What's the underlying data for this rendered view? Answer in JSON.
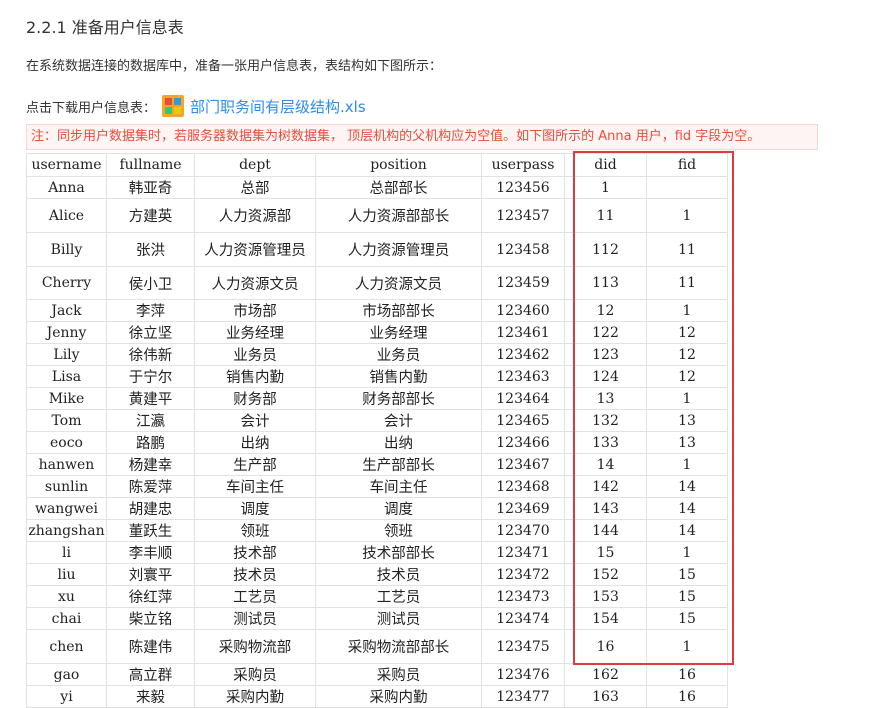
{
  "section_title": "2.2.1 准备用户信息表",
  "intro": "在系统数据连接的数据库中，准备一张用户信息表，表结构如下图所示：",
  "download": {
    "label": "点击下载用户信息表：",
    "file_name": "部门职务间有层级结构.xls",
    "link_color": "#2d8cf0"
  },
  "note": "注：同步用户数据集时，若服务器数据集为树数据集， 顶层机构的父机构应为空值。如下图所示的 Anna 用户，fid 字段为空。",
  "table": {
    "headers": [
      "username",
      "fullname",
      "dept",
      "position",
      "userpass",
      "did",
      "fid"
    ],
    "rows": [
      [
        "Anna",
        "韩亚奇",
        "总部",
        "总部部长",
        "123456",
        "1",
        ""
      ],
      [
        "Alice",
        "方建英",
        "人力资源部",
        "人力资源部部长",
        "123457",
        "11",
        "1"
      ],
      [
        "Billy",
        "张洪",
        "人力资源管理员",
        "人力资源管理员",
        "123458",
        "112",
        "11"
      ],
      [
        "Cherry",
        "侯小卫",
        "人力资源文员",
        "人力资源文员",
        "123459",
        "113",
        "11"
      ],
      [
        "Jack",
        "李萍",
        "市场部",
        "市场部部长",
        "123460",
        "12",
        "1"
      ],
      [
        "Jenny",
        "徐立坚",
        "业务经理",
        "业务经理",
        "123461",
        "122",
        "12"
      ],
      [
        "Lily",
        "徐伟新",
        "业务员",
        "业务员",
        "123462",
        "123",
        "12"
      ],
      [
        "Lisa",
        "于宁尔",
        "销售内勤",
        "销售内勤",
        "123463",
        "124",
        "12"
      ],
      [
        "Mike",
        "黄建平",
        "财务部",
        "财务部部长",
        "123464",
        "13",
        "1"
      ],
      [
        "Tom",
        "江瀛",
        "会计",
        "会计",
        "123465",
        "132",
        "13"
      ],
      [
        "eoco",
        "路鹏",
        "出纳",
        "出纳",
        "123466",
        "133",
        "13"
      ],
      [
        "hanwen",
        "杨建幸",
        "生产部",
        "生产部部长",
        "123467",
        "14",
        "1"
      ],
      [
        "sunlin",
        "陈爱萍",
        "车间主任",
        "车间主任",
        "123468",
        "142",
        "14"
      ],
      [
        "wangwei",
        "胡建忠",
        "调度",
        "调度",
        "123469",
        "143",
        "14"
      ],
      [
        "zhangshan",
        "董跃生",
        "领班",
        "领班",
        "123470",
        "144",
        "14"
      ],
      [
        "li",
        "李丰顺",
        "技术部",
        "技术部部长",
        "123471",
        "15",
        "1"
      ],
      [
        "liu",
        "刘寰平",
        "技术员",
        "技术员",
        "123472",
        "152",
        "15"
      ],
      [
        "xu",
        "徐红萍",
        "工艺员",
        "工艺员",
        "123473",
        "153",
        "15"
      ],
      [
        "chai",
        "柴立铭",
        "测试员",
        "测试员",
        "123474",
        "154",
        "15"
      ],
      [
        "chen",
        "陈建伟",
        "采购物流部",
        "采购物流部部长",
        "123475",
        "16",
        "1"
      ],
      [
        "gao",
        "高立群",
        "采购员",
        "采购员",
        "123476",
        "162",
        "16"
      ],
      [
        "yi",
        "来毅",
        "采购内勤",
        "采购内勤",
        "123477",
        "163",
        "16"
      ]
    ]
  },
  "highlight_color": "#e0393e"
}
